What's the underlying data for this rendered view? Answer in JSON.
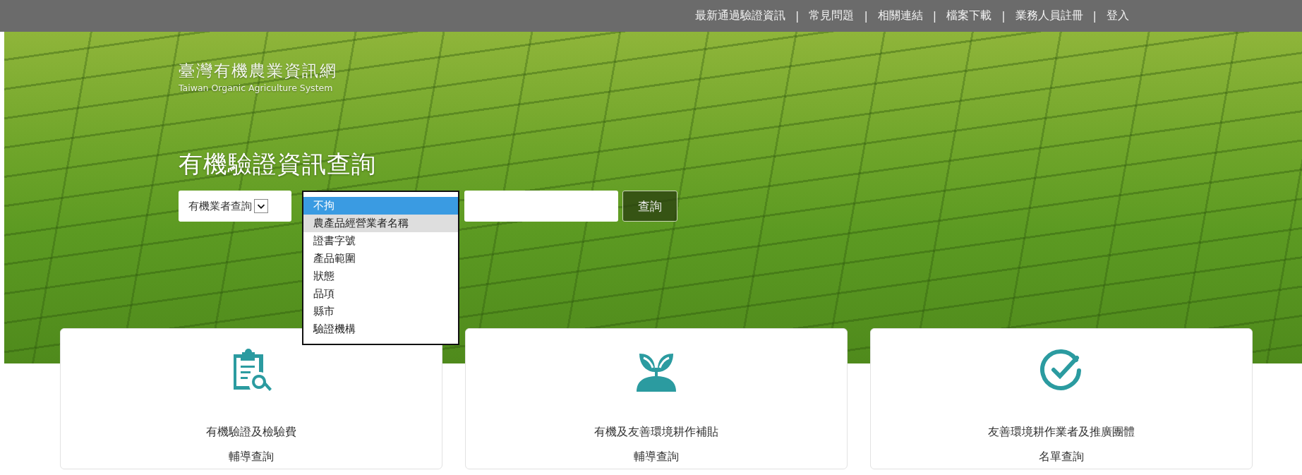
{
  "top_nav": {
    "separator": "|",
    "items": [
      {
        "label": "最新通過驗證資訊"
      },
      {
        "label": "常見問題"
      },
      {
        "label": "相關連結"
      },
      {
        "label": "檔案下載"
      },
      {
        "label": "業務人員註冊"
      },
      {
        "label": "登入"
      }
    ]
  },
  "hero": {
    "site_title": "臺灣有機農業資訊網",
    "site_subtitle": "Taiwan Organic Agriculture System",
    "heading": "有機驗證資訊查詢",
    "query_type_select": {
      "value": "有機業者查詢"
    },
    "field_dropdown": {
      "options": [
        {
          "label": "不拘",
          "selected": true,
          "hovered": false
        },
        {
          "label": "農產品經營業者名稱",
          "selected": false,
          "hovered": true
        },
        {
          "label": "證書字號",
          "selected": false,
          "hovered": false
        },
        {
          "label": "產品範圍",
          "selected": false,
          "hovered": false
        },
        {
          "label": "狀態",
          "selected": false,
          "hovered": false
        },
        {
          "label": "品項",
          "selected": false,
          "hovered": false
        },
        {
          "label": "縣市",
          "selected": false,
          "hovered": false
        },
        {
          "label": "驗證機構",
          "selected": false,
          "hovered": false
        }
      ]
    },
    "search_button": "查詢"
  },
  "cards": [
    {
      "kind": "clipboard",
      "title_lines": [
        "有機驗證及檢驗費",
        "輔導查詢"
      ]
    },
    {
      "kind": "seedling",
      "title_lines": [
        "有機及友善環境耕作補貼",
        "輔導查詢"
      ]
    },
    {
      "kind": "check",
      "title_lines": [
        "友善環境耕作業者及推廣團體",
        "名單查詢"
      ]
    }
  ]
}
